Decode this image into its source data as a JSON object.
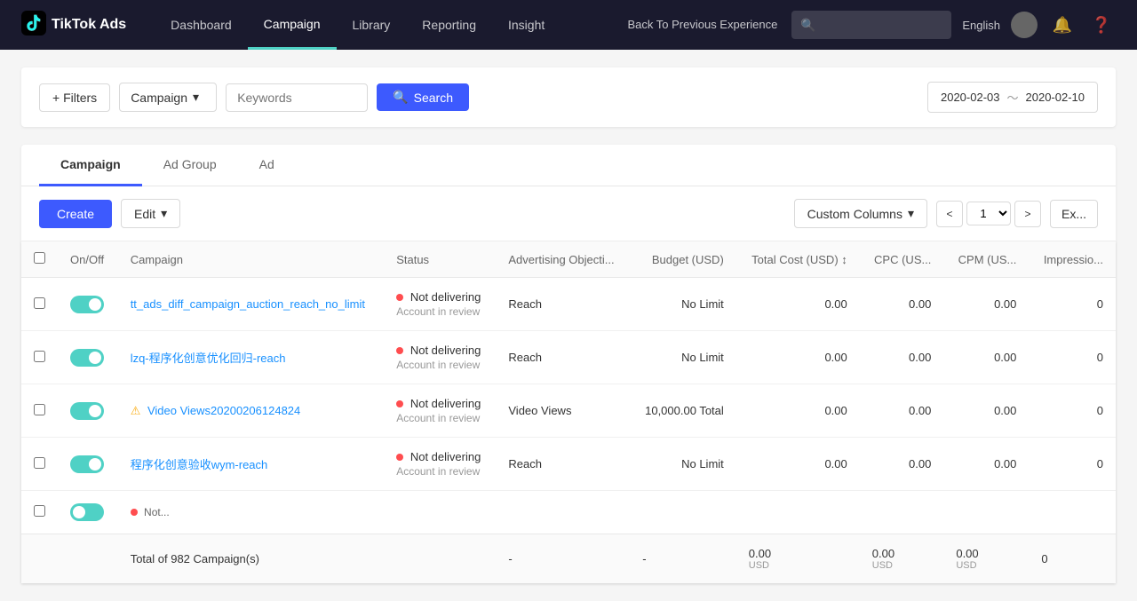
{
  "app": {
    "logo": "TikTok Ads"
  },
  "nav": {
    "items": [
      {
        "id": "dashboard",
        "label": "Dashboard",
        "active": false
      },
      {
        "id": "campaign",
        "label": "Campaign",
        "active": true
      },
      {
        "id": "library",
        "label": "Library",
        "active": false
      },
      {
        "id": "reporting",
        "label": "Reporting",
        "active": false
      },
      {
        "id": "insight",
        "label": "Insight",
        "active": false
      }
    ],
    "back_label": "Back To Previous Experience",
    "lang_label": "English"
  },
  "toolbar": {
    "filter_label": "+ Filters",
    "type_label": "Campaign",
    "keywords_placeholder": "Keywords",
    "search_label": "Search",
    "date_from": "2020-02-03",
    "date_sep": "～",
    "date_to": "2020-02-10"
  },
  "tabs": [
    {
      "id": "campaign",
      "label": "Campaign",
      "active": true
    },
    {
      "id": "adgroup",
      "label": "Ad Group",
      "active": false
    },
    {
      "id": "ad",
      "label": "Ad",
      "active": false
    }
  ],
  "table_toolbar": {
    "create_label": "Create",
    "edit_label": "Edit",
    "custom_columns_label": "Custom Columns",
    "page_prev": "<",
    "page_num": "1",
    "page_next": ">",
    "export_label": "Ex..."
  },
  "table": {
    "headers": [
      {
        "id": "onoff",
        "label": "On/Off"
      },
      {
        "id": "campaign",
        "label": "Campaign"
      },
      {
        "id": "status",
        "label": "Status"
      },
      {
        "id": "objective",
        "label": "Advertising Objecti..."
      },
      {
        "id": "budget",
        "label": "Budget (USD)"
      },
      {
        "id": "totalcost",
        "label": "Total Cost (USD) ↕"
      },
      {
        "id": "cpc",
        "label": "CPC (US..."
      },
      {
        "id": "cpm",
        "label": "CPM (US..."
      },
      {
        "id": "impressions",
        "label": "Impressio..."
      }
    ],
    "rows": [
      {
        "id": 1,
        "on": true,
        "campaign_name": "tt_ads_diff_campaign_auction_reach_no_limit",
        "status_text": "Not delivering",
        "status_sub": "Account in review",
        "objective": "Reach",
        "budget": "No Limit",
        "total_cost": "0.00",
        "cpc": "0.00",
        "cpm": "0.00",
        "impressions": "0",
        "has_warning": false
      },
      {
        "id": 2,
        "on": true,
        "campaign_name": "lzq-程序化创意优化回归-reach",
        "status_text": "Not delivering",
        "status_sub": "Account in review",
        "objective": "Reach",
        "budget": "No Limit",
        "total_cost": "0.00",
        "cpc": "0.00",
        "cpm": "0.00",
        "impressions": "0",
        "has_warning": false
      },
      {
        "id": 3,
        "on": true,
        "campaign_name": "Video Views20200206124824",
        "status_text": "Not delivering",
        "status_sub": "Account in review",
        "objective": "Video Views",
        "budget": "10,000.00 Total",
        "total_cost": "0.00",
        "cpc": "0.00",
        "cpm": "0.00",
        "impressions": "0",
        "has_warning": true
      },
      {
        "id": 4,
        "on": true,
        "campaign_name": "程序化创意验收wym-reach",
        "status_text": "Not delivering",
        "status_sub": "Account in review",
        "objective": "Reach",
        "budget": "No Limit",
        "total_cost": "0.00",
        "cpc": "0.00",
        "cpm": "0.00",
        "impressions": "0",
        "has_warning": false
      },
      {
        "id": 5,
        "on": false,
        "campaign_name": "...",
        "status_text": "Not",
        "status_sub": "",
        "objective": "",
        "budget": "",
        "total_cost": "",
        "cpc": "",
        "cpm": "",
        "impressions": "",
        "has_warning": false,
        "partial": true
      }
    ],
    "footer": {
      "total_label": "Total of 982 Campaign(s)",
      "dash": "-",
      "total_cost": "0.00",
      "total_cost_unit": "USD",
      "cpc": "0.00",
      "cpc_unit": "USD",
      "cpm": "0.00",
      "cpm_unit": "USD",
      "impressions": "0"
    }
  }
}
